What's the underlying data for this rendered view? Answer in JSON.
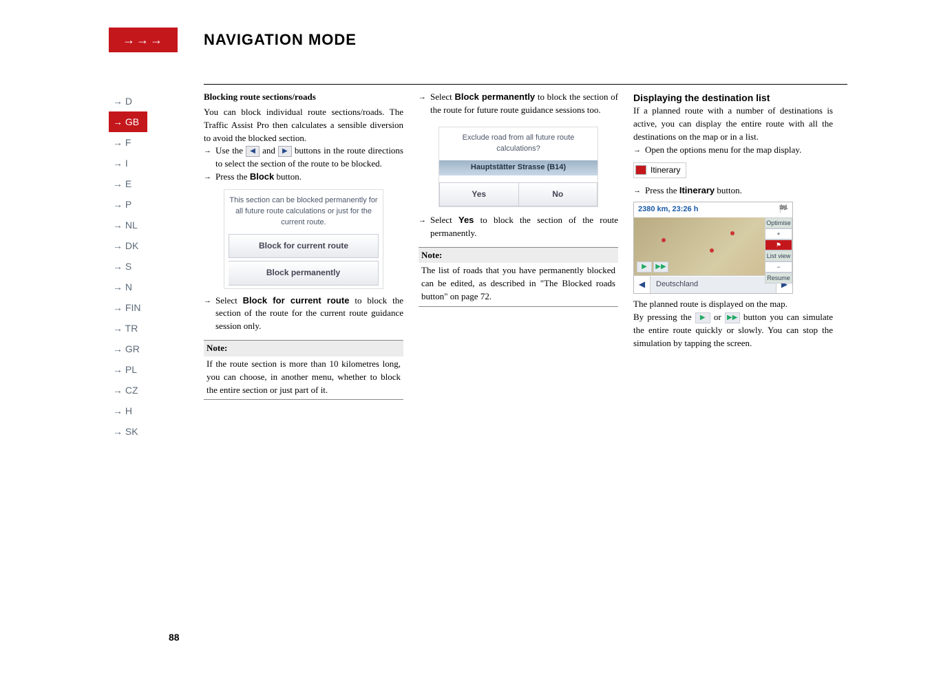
{
  "header": {
    "arrows": "→→→",
    "title": "NAVIGATION MODE"
  },
  "sidebar": {
    "items": [
      {
        "label": "→ D"
      },
      {
        "label": "→ GB",
        "active": true
      },
      {
        "label": "→ F"
      },
      {
        "label": "→ I"
      },
      {
        "label": "→ E"
      },
      {
        "label": "→ P"
      },
      {
        "label": "→ NL"
      },
      {
        "label": "→ DK"
      },
      {
        "label": "→ S"
      },
      {
        "label": "→ N"
      },
      {
        "label": "→ FIN"
      },
      {
        "label": "→ TR"
      },
      {
        "label": "→ GR"
      },
      {
        "label": "→ PL"
      },
      {
        "label": "→ CZ"
      },
      {
        "label": "→ H"
      },
      {
        "label": "→ SK"
      }
    ]
  },
  "col1": {
    "heading": "Blocking route sections/roads",
    "p1": "You can block individual route sections/roads. The Traffic Assist Pro then calculates a sensible diversion to avoid the blocked section.",
    "bullet1_a": "Use the ",
    "bullet1_b": " and ",
    "bullet1_c": " buttons in the route directions to select the section of the route to be blocked.",
    "bullet2": "Press the ",
    "bullet2_bold": "Block",
    "bullet2_end": " button.",
    "ui1": {
      "msg": "This section can be blocked permanently for all future route calculations or just for the current route.",
      "btn1": "Block for current route",
      "btn2": "Block permanently"
    },
    "bullet3": "Select ",
    "bullet3_bold": "Block for current route",
    "bullet3_end": " to block the section of the route for the current route guidance session only.",
    "note_head": "Note:",
    "note_body": "If the route section is more than 10 kilometres long, you can choose, in another menu, whether to block the entire section or just part of it."
  },
  "col2": {
    "bullet1": "Select ",
    "bullet1_bold": "Block permanently",
    "bullet1_end": " to block the section of the route for future route guidance sessions too.",
    "ui": {
      "line1": "Exclude road from all future route calculations?",
      "line2": "Hauptstätter Strasse (B14)",
      "yes": "Yes",
      "no": "No"
    },
    "bullet2": "Select ",
    "bullet2_bold": "Yes",
    "bullet2_end": " to block the section of the route permanently.",
    "note_head": "Note:",
    "note_body": "The list of roads that you have permanently blocked can be edited, as described in \"The Blocked roads button\" on page 72."
  },
  "col3": {
    "heading": "Displaying the destination list",
    "p1": "If a planned route with a number of destinations is active, you can display the entire route with all the destinations on the map or in a list.",
    "bullet1": "Open the options menu for the map display.",
    "chip": "Itinerary",
    "bullet2": "Press the ",
    "bullet2_bold": "Itinerary",
    "bullet2_end": " button.",
    "map": {
      "dist": "2380 km,  23:26 h",
      "opt": "Optimise",
      "list": "List view",
      "resume": "Resume",
      "country": "Deutschland"
    },
    "p2": "The planned route is displayed on the map.",
    "p3a": "By pressing the ",
    "p3b": " or ",
    "p3c": " button you can simulate the entire route quickly or slowly. You can stop the simulation by tapping the screen."
  },
  "page_number": "88"
}
